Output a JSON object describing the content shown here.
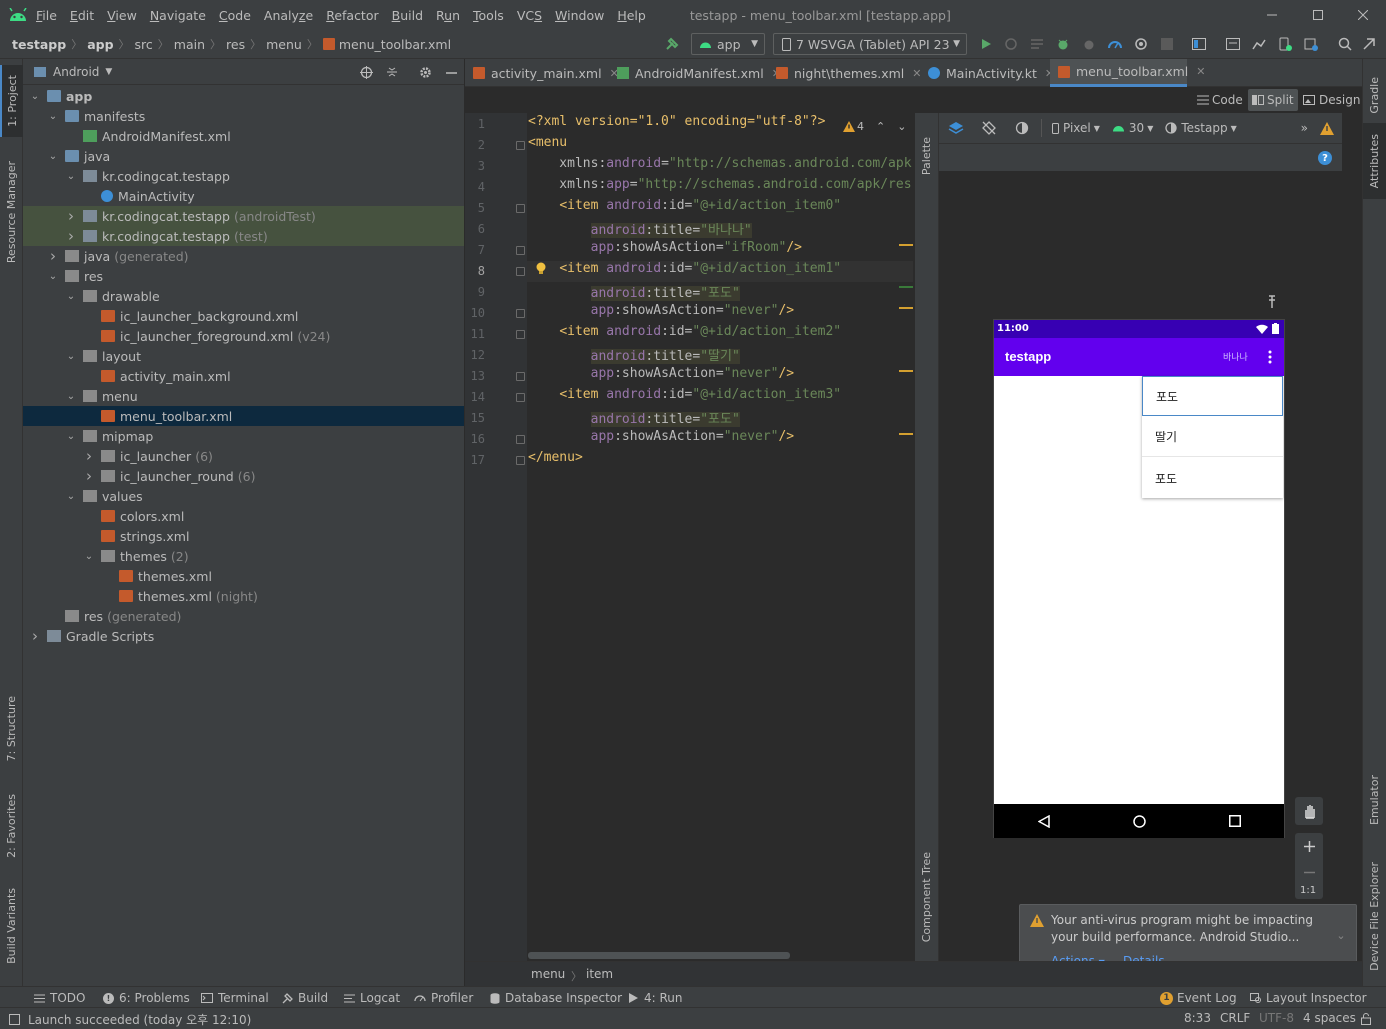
{
  "menubar": {
    "items": [
      "File",
      "Edit",
      "View",
      "Navigate",
      "Code",
      "Analyze",
      "Refactor",
      "Build",
      "Run",
      "Tools",
      "VCS",
      "Window",
      "Help"
    ],
    "mnemonics": [
      "F",
      "E",
      "V",
      "N",
      "C",
      "z",
      "R",
      "B",
      "u",
      "T",
      "S",
      "W",
      "H"
    ],
    "window_title": "testapp - menu_toolbar.xml [testapp.app]"
  },
  "navbar": {
    "crumbs": [
      "testapp",
      "app",
      "src",
      "main",
      "res",
      "menu",
      "menu_toolbar.xml"
    ],
    "run_config": "app",
    "device": "7  WSVGA (Tablet) API 23"
  },
  "project": {
    "view_label": "Android",
    "tree": [
      {
        "label": "app",
        "depth": 0,
        "arrow": "down",
        "icon": "folder",
        "bold": true
      },
      {
        "label": "manifests",
        "depth": 1,
        "arrow": "down",
        "icon": "folder"
      },
      {
        "label": "AndroidManifest.xml",
        "depth": 2,
        "arrow": "",
        "icon": "manifest"
      },
      {
        "label": "java",
        "depth": 1,
        "arrow": "down",
        "icon": "folder"
      },
      {
        "label": "kr.codingcat.testapp",
        "depth": 2,
        "arrow": "down",
        "icon": "package"
      },
      {
        "label": "MainActivity",
        "depth": 3,
        "arrow": "",
        "icon": "kotlin"
      },
      {
        "label": "kr.codingcat.testapp",
        "depth": 2,
        "arrow": "right",
        "icon": "package",
        "suffix": "(androidTest)",
        "highlight": true
      },
      {
        "label": "kr.codingcat.testapp",
        "depth": 2,
        "arrow": "right",
        "icon": "package",
        "suffix": "(test)",
        "highlight": true
      },
      {
        "label": "java",
        "depth": 1,
        "arrow": "right",
        "icon": "folder-res",
        "suffix": "(generated)"
      },
      {
        "label": "res",
        "depth": 1,
        "arrow": "down",
        "icon": "folder-res"
      },
      {
        "label": "drawable",
        "depth": 2,
        "arrow": "down",
        "icon": "folder-res"
      },
      {
        "label": "ic_launcher_background.xml",
        "depth": 3,
        "arrow": "",
        "icon": "xml"
      },
      {
        "label": "ic_launcher_foreground.xml",
        "depth": 3,
        "arrow": "",
        "icon": "xml",
        "suffix": "(v24)"
      },
      {
        "label": "layout",
        "depth": 2,
        "arrow": "down",
        "icon": "folder-res"
      },
      {
        "label": "activity_main.xml",
        "depth": 3,
        "arrow": "",
        "icon": "xml"
      },
      {
        "label": "menu",
        "depth": 2,
        "arrow": "down",
        "icon": "folder-res"
      },
      {
        "label": "menu_toolbar.xml",
        "depth": 3,
        "arrow": "",
        "icon": "xml",
        "selected": true
      },
      {
        "label": "mipmap",
        "depth": 2,
        "arrow": "down",
        "icon": "folder-res"
      },
      {
        "label": "ic_launcher",
        "depth": 3,
        "arrow": "right",
        "icon": "folder-res",
        "suffix": "(6)"
      },
      {
        "label": "ic_launcher_round",
        "depth": 3,
        "arrow": "right",
        "icon": "folder-res",
        "suffix": "(6)"
      },
      {
        "label": "values",
        "depth": 2,
        "arrow": "down",
        "icon": "folder-res"
      },
      {
        "label": "colors.xml",
        "depth": 3,
        "arrow": "",
        "icon": "xml"
      },
      {
        "label": "strings.xml",
        "depth": 3,
        "arrow": "",
        "icon": "xml"
      },
      {
        "label": "themes",
        "depth": 3,
        "arrow": "down",
        "icon": "folder-res",
        "suffix": "(2)"
      },
      {
        "label": "themes.xml",
        "depth": 4,
        "arrow": "",
        "icon": "xml"
      },
      {
        "label": "themes.xml",
        "depth": 4,
        "arrow": "",
        "icon": "xml",
        "suffix": "(night)"
      },
      {
        "label": "res",
        "depth": 1,
        "arrow": "",
        "icon": "folder-res",
        "suffix": "(generated)"
      },
      {
        "label": "Gradle Scripts",
        "depth": 0,
        "arrow": "right",
        "icon": "gradle"
      }
    ]
  },
  "left_stripe": {
    "project_tab": "1: Project",
    "resource_tab": "Resource Manager",
    "structure_tab": "7: Structure",
    "favorites_tab": "2: Favorites",
    "build_variants_tab": "Build Variants"
  },
  "right_stripe": {
    "gradle_tab": "Gradle",
    "attributes_tab": "Attributes",
    "emulator_tab": "Emulator",
    "device_explorer_tab": "Device File Explorer"
  },
  "editor": {
    "tabs": [
      {
        "label": "activity_main.xml",
        "icon": "xml"
      },
      {
        "label": "AndroidManifest.xml",
        "icon": "manifest"
      },
      {
        "label": "night\\themes.xml",
        "icon": "xml"
      },
      {
        "label": "MainActivity.kt",
        "icon": "kotlin"
      },
      {
        "label": "menu_toolbar.xml",
        "icon": "xml",
        "active": true
      }
    ],
    "view_modes": {
      "code": "Code",
      "split": "Split",
      "design": "Design"
    },
    "warning_count": "4",
    "line_numbers": [
      "1",
      "2",
      "3",
      "4",
      "5",
      "6",
      "7",
      "8",
      "9",
      "10",
      "11",
      "12",
      "13",
      "14",
      "15",
      "16",
      "17"
    ],
    "breadcrumbs": [
      "menu",
      "item"
    ]
  },
  "code": {
    "l1_decl": "<?xml version=\"1.0\" encoding=\"utf-8\"?>",
    "l2": "<menu",
    "l3_attr": "    xmlns:",
    "l3_ns": "android",
    "l3_eq": "=",
    "l3_val": "\"http://schemas.android.com/apk",
    "l4_attr": "    xmlns:",
    "l4_ns": "app",
    "l4_eq": "=",
    "l4_val": "\"http://schemas.android.com/apk/res",
    "item_open": "<item ",
    "android_ns": "android",
    "id_attr": ":id=",
    "title_attr": ":title=",
    "app_ns": "app",
    "show_attr": ":showAsAction=",
    "id0": "\"@+id/action_item0\"",
    "title0": "\"바나나\"",
    "show0": "\"ifRoom\"",
    "id1": "\"@+id/action_item1\"",
    "title1": "\"포도\"",
    "show1": "\"never\"",
    "id2": "\"@+id/action_item2\"",
    "title2": "\"딸기\"",
    "show2": "\"never\"",
    "id3": "\"@+id/action_item3\"",
    "title3": "\"포도\"",
    "show3": "\"never\"",
    "self_close": "/>",
    "menu_close": "</menu>"
  },
  "design": {
    "device": "Pixel",
    "api": "30",
    "theme": "Testapp",
    "palette_tab": "Palette",
    "component_tree_tab": "Component Tree",
    "zoom_ratio": "1:1"
  },
  "phone": {
    "time": "11:00",
    "app_title": "testapp",
    "action_item": "바나나",
    "overflow_items": [
      "포도",
      "딸기",
      "포도"
    ],
    "colors": {
      "status": "#3700b3",
      "appbar": "#6200ee"
    }
  },
  "notification": {
    "line1": "Your anti-virus program might be impacting",
    "line2": "your build performance. Android Studio...",
    "actions_label": "Actions",
    "details_label": "Details"
  },
  "bottom_tools": {
    "todo": "TODO",
    "problems": "6: Problems",
    "terminal": "Terminal",
    "build": "Build",
    "logcat": "Logcat",
    "profiler": "Profiler",
    "db_inspector": "Database Inspector",
    "run": "4: Run",
    "event_log_count": "1",
    "event_log": "Event Log",
    "layout_inspector": "Layout Inspector"
  },
  "status": {
    "message": "Launch succeeded (today 오후 12:10)",
    "position": "8:33",
    "line_sep": "CRLF",
    "encoding": "UTF-8",
    "indent": "4 spaces"
  }
}
